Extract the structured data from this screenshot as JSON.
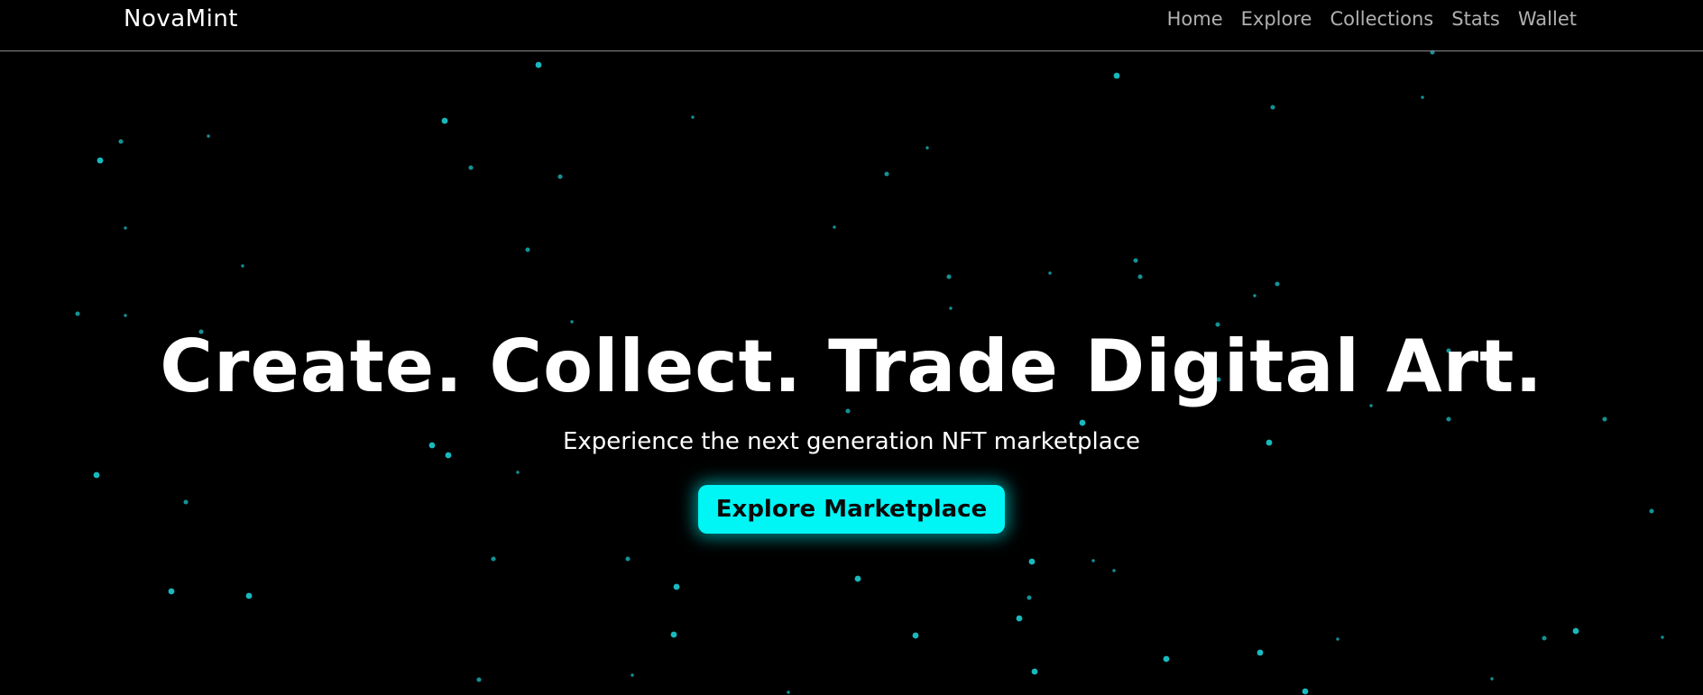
{
  "colors": {
    "background": "#000000",
    "accent": "#00f5f5",
    "text": "#ffffff",
    "nav_text": "#b0b0b0",
    "star": "#19c3c8"
  },
  "navbar": {
    "brand": "NovaMint",
    "links": [
      "Home",
      "Explore",
      "Collections",
      "Stats",
      "Wallet"
    ]
  },
  "hero": {
    "title": "Create. Collect. Trade Digital Art.",
    "subtitle": "Experience the next generation NFT marketplace",
    "cta_label": "Explore Marketplace"
  },
  "background": {
    "decoration": "starfield"
  }
}
